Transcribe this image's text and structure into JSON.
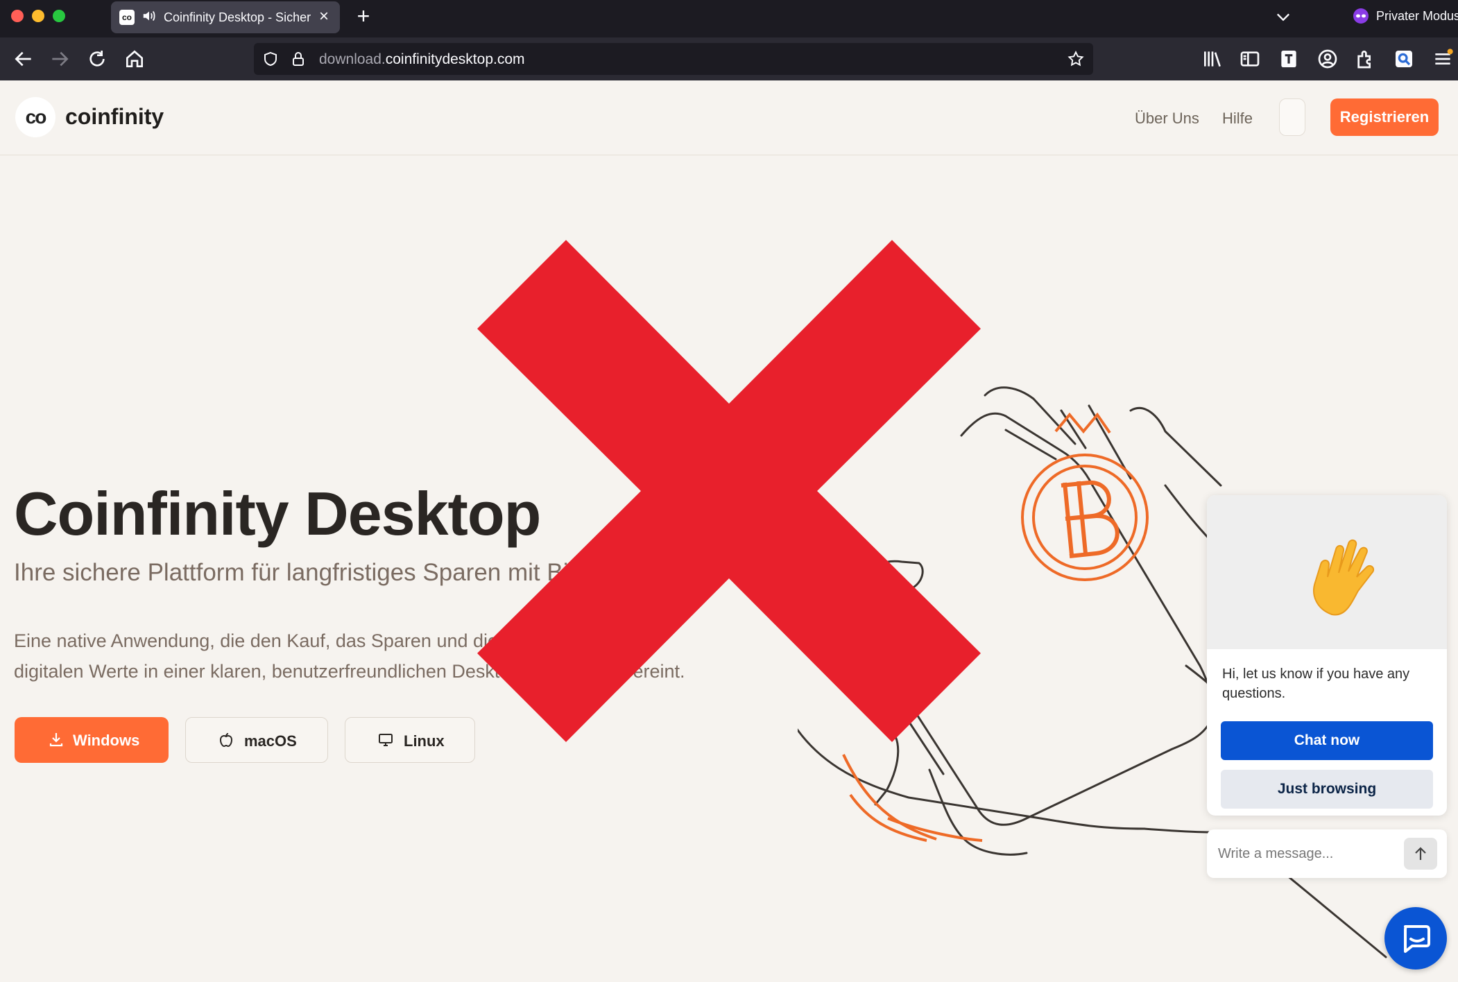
{
  "browser": {
    "tab_title": "Coinfinity Desktop - Sichere",
    "tab_favicon": "co",
    "private_label": "Privater Modus",
    "url_subdomain": "download.",
    "url_domain": "coinfinitydesktop.com",
    "icons": [
      "back-arrow-icon",
      "forward-arrow-icon",
      "reload-icon",
      "home-icon",
      "shield-icon",
      "lock-icon",
      "star-icon",
      "library-icon",
      "sidebar-icon",
      "reader-icon",
      "account-icon",
      "extensions-icon",
      "search-extension-icon",
      "menu-icon"
    ]
  },
  "header": {
    "logo_mark": "co",
    "logo_text": "coinfinity",
    "nav": [
      "Über Uns",
      "Hilfe"
    ],
    "register_label": "Registrieren"
  },
  "hero": {
    "title": "Coinfinity Desktop",
    "subtitle": "Ihre sichere Plattform für langfristiges Sparen mit Bi",
    "description": "Eine native Anwendung, die den Kauf, das Sparen und die Verwaltung Ihrer digitalen Werte in einer klaren, benutzerfreundlichen Desktop-Umgebung vereint.",
    "buttons": [
      {
        "label": "Windows",
        "icon": "download-icon"
      },
      {
        "label": "macOS",
        "icon": "apple-icon"
      },
      {
        "label": "Linux",
        "icon": "monitor-icon"
      }
    ]
  },
  "chat": {
    "message": "Hi, let us know if you have any questions.",
    "chat_now_label": "Chat now",
    "just_browsing_label": "Just browsing",
    "input_placeholder": "Write a message..."
  },
  "colors": {
    "brand_orange": "#ff6b35",
    "chat_blue": "#0a55d4",
    "warning_red": "#e8202c",
    "background": "#f6f3ef"
  }
}
